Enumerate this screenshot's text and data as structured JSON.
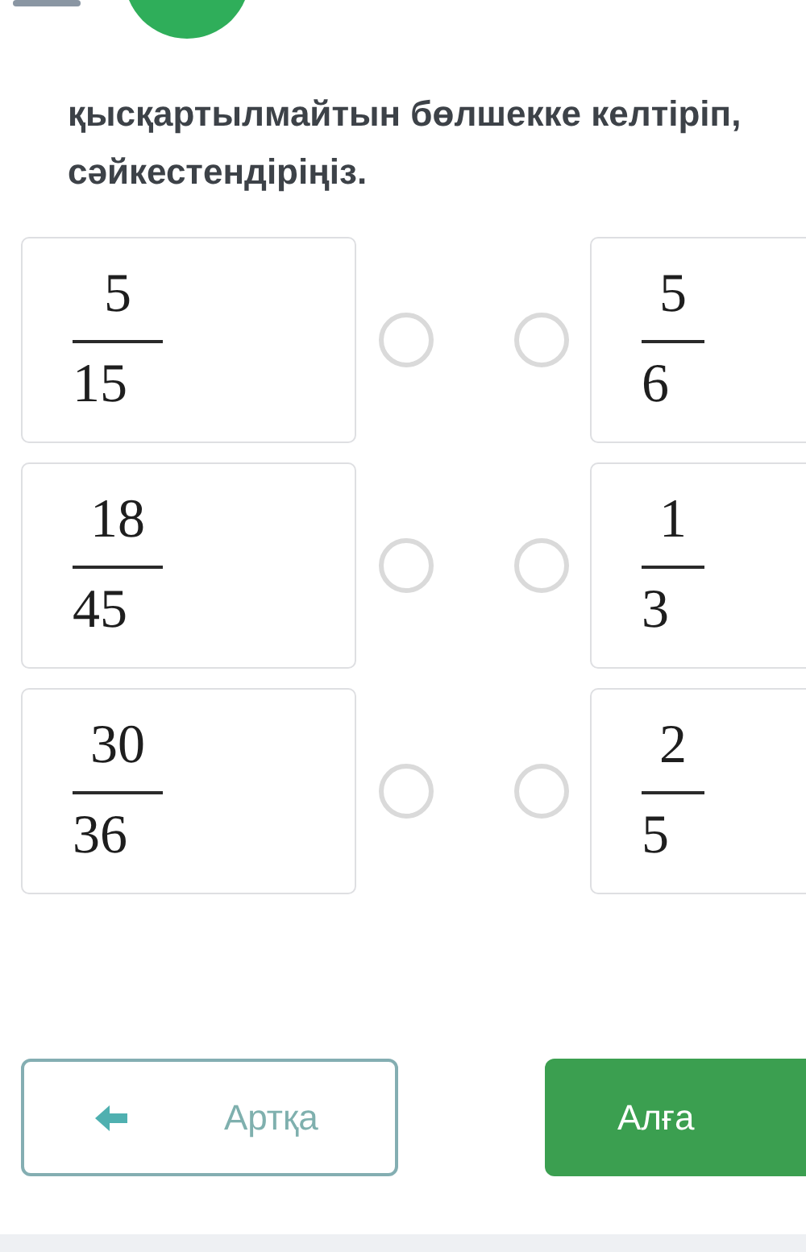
{
  "question": "қысқартылмайтын бөлшекке келтіріп, сәйкестендіріңіз.",
  "rows": [
    {
      "left": {
        "numerator": "5",
        "denominator": "15",
        "selected": false
      },
      "right": {
        "numerator": "5",
        "denominator": "6",
        "selected": false
      }
    },
    {
      "left": {
        "numerator": "18",
        "denominator": "45",
        "selected": false
      },
      "right": {
        "numerator": "1",
        "denominator": "3",
        "selected": false
      }
    },
    {
      "left": {
        "numerator": "30",
        "denominator": "36",
        "selected": false
      },
      "right": {
        "numerator": "2",
        "denominator": "5",
        "selected": false
      }
    }
  ],
  "buttons": {
    "back": "Артқа",
    "next": "Алға"
  }
}
